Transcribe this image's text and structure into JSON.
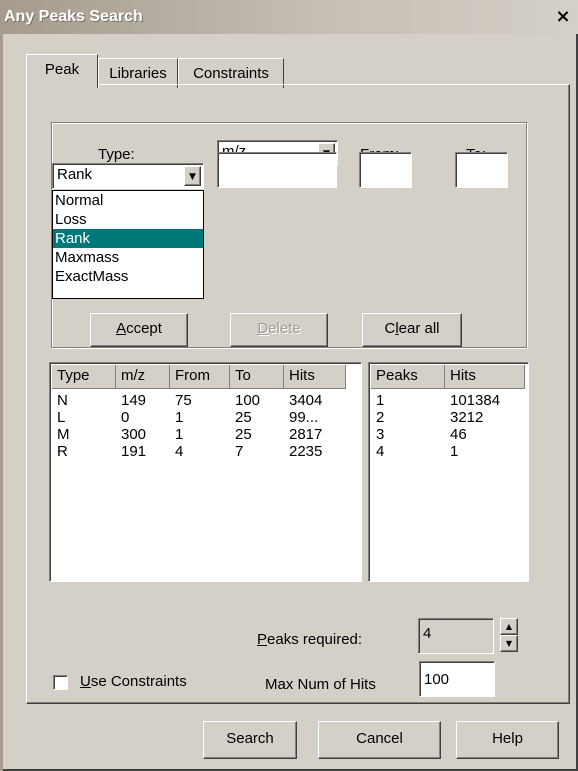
{
  "window": {
    "title": "Any Peaks Search",
    "close_glyph": "×"
  },
  "tabs": [
    "Peak",
    "Libraries",
    "Constraints"
  ],
  "labels": {
    "type": "Type:",
    "from": "From:",
    "to": "To:"
  },
  "mz_combo": {
    "value": "m/z"
  },
  "type_combo": {
    "value": "Rank"
  },
  "type_options": [
    "Normal",
    "Loss",
    "Rank",
    "Maxmass",
    "ExactMass"
  ],
  "type_selected_index": 2,
  "inputs": {
    "mz_value": "",
    "from_value": "",
    "to_value": ""
  },
  "buttons": {
    "accept_u": "A",
    "accept_rest": "ccept",
    "delete_u": "D",
    "delete_rest": "elete",
    "clear_pre": "C",
    "clear_u": "l",
    "clear_rest": "ear all",
    "search": "Search",
    "cancel": "Cancel",
    "help": "Help"
  },
  "peak_table": {
    "columns": [
      "Type",
      "m/z",
      "From",
      "To",
      "Hits"
    ],
    "rows": [
      [
        "N",
        "149",
        "75",
        "100",
        "3404"
      ],
      [
        "L",
        "0",
        "1",
        "25",
        "99..."
      ],
      [
        "M",
        "300",
        "1",
        "25",
        "2817"
      ],
      [
        "R",
        "191",
        "4",
        "7",
        "2235"
      ]
    ]
  },
  "hits_table": {
    "columns": [
      "Peaks",
      "Hits"
    ],
    "rows": [
      [
        "1",
        "101384"
      ],
      [
        "2",
        "3212"
      ],
      [
        "3",
        "46"
      ],
      [
        "4",
        "1"
      ]
    ]
  },
  "peaks_required": {
    "label_u": "P",
    "label_rest": "eaks required:",
    "value": "4"
  },
  "use_constraints": {
    "label_u": "U",
    "label_rest": "se Constraints",
    "checked": false
  },
  "max_hits": {
    "label": "Max Num of Hits",
    "value": "100"
  },
  "colors": {
    "selection": "#00787a",
    "face": "#d4d0c8"
  }
}
